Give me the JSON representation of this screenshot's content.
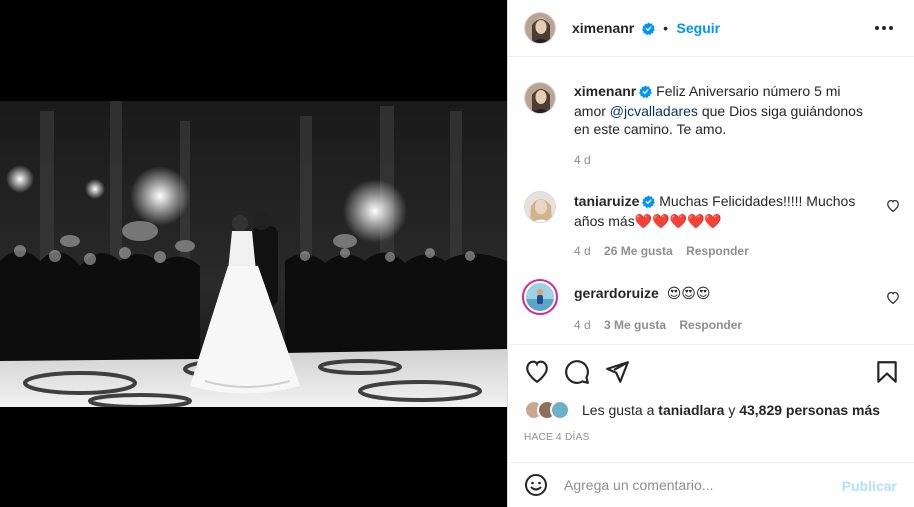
{
  "post": {
    "username": "ximenanr",
    "follow_label": "Seguir",
    "dot": "•",
    "photo_icon": "wedding-dance-photo"
  },
  "caption": {
    "username": "ximenanr",
    "text_before": "Feliz Aniversario número 5 mi amor",
    "mention": "@jcvalladares",
    "text_after": "que Dios siga guiándonos en este camino. Te amo.",
    "time": "4 d"
  },
  "comments": [
    {
      "username": "taniaruize",
      "text": "Muchas Felicidades!!!!! Muchos años más❤️❤️❤️❤️❤️",
      "time": "4 d",
      "likes": "26 Me gusta",
      "reply": "Responder"
    },
    {
      "username": "gerardoruize",
      "text": "😍😍😍",
      "time": "4 d",
      "likes": "3 Me gusta",
      "reply": "Responder"
    }
  ],
  "likes": {
    "prefix": "Les gusta a",
    "user": "taniadlara",
    "middle": "y",
    "count": "43,829 personas más"
  },
  "timestamp": "HACE 4 DÍAS",
  "add_comment": {
    "placeholder": "Agrega un comentario...",
    "publish_label": "Publicar"
  },
  "colors": {
    "link_blue": "#0095f6",
    "mention_blue": "#00376b",
    "muted": "#8e8e8e",
    "text": "#262626",
    "publish_disabled": "#b2dffc"
  }
}
